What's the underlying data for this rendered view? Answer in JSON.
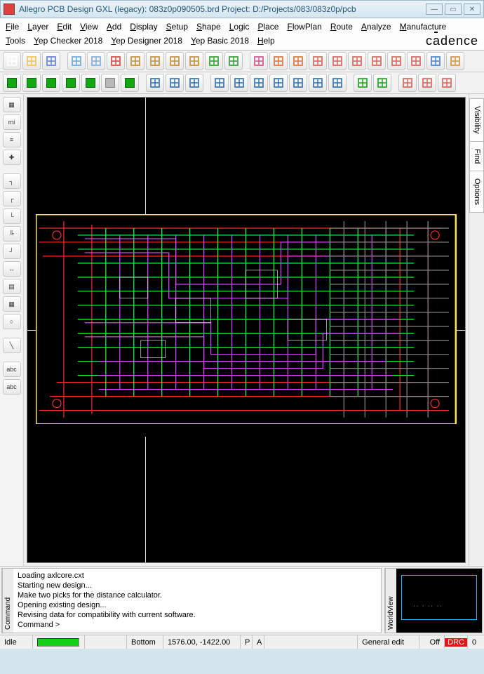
{
  "title": "Allegro PCB Design GXL (legacy): 083z0p090505.brd  Project: D:/Projects/083/083z0p/pcb",
  "menu": [
    {
      "label": "File",
      "ul": "F",
      "rest": "ile"
    },
    {
      "label": "Layer",
      "ul": "L",
      "rest": "ayer"
    },
    {
      "label": "Edit",
      "ul": "E",
      "rest": "dit"
    },
    {
      "label": "View",
      "ul": "V",
      "rest": "iew"
    },
    {
      "label": "Add",
      "ul": "A",
      "rest": "dd"
    },
    {
      "label": "Display",
      "ul": "D",
      "rest": "isplay"
    },
    {
      "label": "Setup",
      "ul": "S",
      "rest": "etup"
    },
    {
      "label": "Shape",
      "ul": "S",
      "rest": "hape"
    },
    {
      "label": "Logic",
      "ul": "L",
      "rest": "ogic"
    },
    {
      "label": "Place",
      "ul": "P",
      "rest": "lace"
    },
    {
      "label": "FlowPlan",
      "ul": "F",
      "rest": "lowPlan"
    },
    {
      "label": "Route",
      "ul": "R",
      "rest": "oute"
    },
    {
      "label": "Analyze",
      "ul": "A",
      "rest": "nalyze"
    },
    {
      "label": "Manufacture",
      "ul": "M",
      "rest": "anufacture"
    },
    {
      "label": "Tools",
      "ul": "T",
      "rest": "ools"
    },
    {
      "label": "Yep Checker 2018",
      "ul": "Y",
      "rest": "ep Checker 2018"
    },
    {
      "label": "Yep Designer 2018",
      "ul": "Y",
      "rest": "ep Designer 2018"
    },
    {
      "label": "Yep Basic 2018",
      "ul": "Y",
      "rest": "ep Basic 2018"
    },
    {
      "label": "Help",
      "ul": "H",
      "rest": "elp"
    }
  ],
  "brand": "cādence",
  "toolbar1": [
    {
      "name": "new-file-icon",
      "color": "#fff"
    },
    {
      "name": "open-file-icon",
      "color": "#f5c04a"
    },
    {
      "name": "save-icon",
      "color": "#5a7fd8"
    },
    {
      "sep": true
    },
    {
      "name": "move-icon",
      "color": "#5fa6e0"
    },
    {
      "name": "copy-icon",
      "color": "#7aa9da"
    },
    {
      "name": "delete-icon",
      "color": "#d8403a"
    },
    {
      "name": "undo-icon",
      "color": "#c48b2c"
    },
    {
      "name": "redo-icon",
      "color": "#c48b2c"
    },
    {
      "name": "down-arrow-icon",
      "color": "#c48b2c"
    },
    {
      "name": "down-arrow2-icon",
      "color": "#c48b2c"
    },
    {
      "name": "flag-icon",
      "color": "#22a122"
    },
    {
      "name": "pin-icon",
      "color": "#2a9a2a"
    },
    {
      "sep": true
    },
    {
      "name": "grid-toggle-icon",
      "color": "#d24f84"
    },
    {
      "name": "colors-icon",
      "color": "#e07030"
    },
    {
      "name": "layers-icon",
      "color": "#e07030"
    },
    {
      "name": "zoom-in-icon",
      "color": "#d85f54"
    },
    {
      "name": "zoom-out-icon",
      "color": "#d85f54"
    },
    {
      "name": "zoom-fit-icon",
      "color": "#d85f54"
    },
    {
      "name": "zoom-window-icon",
      "color": "#d85f54"
    },
    {
      "name": "zoom-prev-icon",
      "color": "#d85f54"
    },
    {
      "name": "crosshair-icon",
      "color": "#d85f54"
    },
    {
      "name": "refresh-icon",
      "color": "#3f7fd0"
    },
    {
      "name": "3d-view-icon",
      "color": "#d68f33"
    }
  ],
  "toolbar2": [
    {
      "name": "place-mode1",
      "kind": "green"
    },
    {
      "name": "place-mode2",
      "kind": "green"
    },
    {
      "name": "place-mode3",
      "kind": "green"
    },
    {
      "name": "place-mode4",
      "kind": "green"
    },
    {
      "name": "place-mode5",
      "kind": "green"
    },
    {
      "name": "place-mode6",
      "kind": "gray"
    },
    {
      "name": "place-mode7",
      "kind": "green"
    },
    {
      "sep": true
    },
    {
      "name": "shape-rect",
      "c": "#2c6fb0"
    },
    {
      "name": "shape-line",
      "c": "#2c6fb0"
    },
    {
      "name": "shape-circle",
      "c": "#2c6fb0"
    },
    {
      "sep": true
    },
    {
      "name": "select-arrow",
      "c": "#2c6fb0"
    },
    {
      "name": "etch-edit1",
      "c": "#2c6fb0"
    },
    {
      "name": "etch-edit2",
      "c": "#2c6fb0"
    },
    {
      "name": "etch-edit3",
      "c": "#2c6fb0"
    },
    {
      "name": "etch-edit4",
      "c": "#2c6fb0"
    },
    {
      "name": "etch-edit5",
      "c": "#2c6fb0"
    },
    {
      "name": "etch-edit6",
      "c": "#2c6fb0"
    },
    {
      "sep": true
    },
    {
      "name": "route1",
      "c": "#17a017"
    },
    {
      "name": "route2",
      "c": "#17a017"
    },
    {
      "sep": true
    },
    {
      "name": "dim-h",
      "c": "#d85f54"
    },
    {
      "name": "dim-v",
      "c": "#d85f54"
    },
    {
      "name": "dim-vh",
      "c": "#d85f54"
    }
  ],
  "lefttools": [
    {
      "name": "lt-chip",
      "glyph": "▦"
    },
    {
      "name": "lt-micro",
      "glyph": "mi"
    },
    {
      "name": "lt-wire",
      "glyph": "≡"
    },
    {
      "name": "lt-cross",
      "glyph": "✚"
    },
    {
      "sep": true
    },
    {
      "name": "lt-route-a",
      "glyph": "┐"
    },
    {
      "name": "lt-route-b",
      "glyph": "┌"
    },
    {
      "name": "lt-route-c",
      "glyph": "└"
    },
    {
      "name": "lt-route-d",
      "glyph": "╚"
    },
    {
      "name": "lt-route-e",
      "glyph": "┘"
    },
    {
      "name": "lt-dist",
      "glyph": "↔"
    },
    {
      "name": "lt-hatch",
      "glyph": "▤"
    },
    {
      "name": "lt-grid",
      "glyph": "▦"
    },
    {
      "name": "lt-pin",
      "glyph": "○"
    },
    {
      "sep": true
    },
    {
      "name": "lt-line",
      "glyph": "╲"
    },
    {
      "sep": true
    },
    {
      "name": "lt-text1",
      "glyph": "abc"
    },
    {
      "name": "lt-text2",
      "glyph": "abc"
    }
  ],
  "righttabs": [
    "Visibility",
    "Find",
    "Options"
  ],
  "command": {
    "label": "Command",
    "lines": [
      "Loading axlcore.cxt",
      "Starting new design...",
      "Make two picks for the distance calculator.",
      "Opening existing design...",
      "Revising data for compatibility with current software.",
      "Command >"
    ]
  },
  "worldview": {
    "label": "WorldView"
  },
  "status": {
    "idle": "Idle",
    "layer": "Bottom",
    "coords": "1576.00, -1422.00",
    "p": "P",
    "a": "A",
    "mode": "General edit",
    "drc_mode": "Off",
    "drc": "DRC",
    "count": "0"
  }
}
